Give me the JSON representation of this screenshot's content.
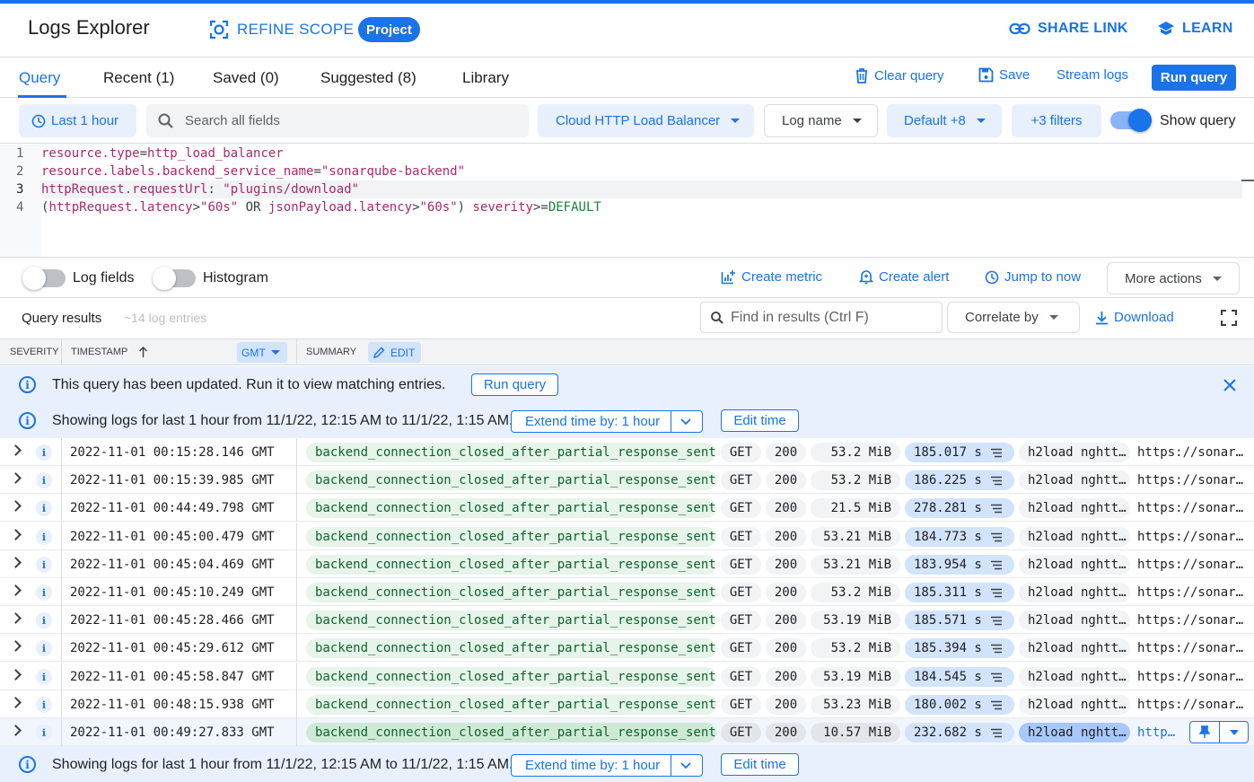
{
  "header": {
    "title": "Logs Explorer",
    "refine_scope": "REFINE SCOPE",
    "scope_badge": "Project",
    "share_link": "SHARE LINK",
    "learn": "LEARN"
  },
  "tabs": {
    "query": "Query",
    "recent": "Recent (1)",
    "saved": "Saved (0)",
    "suggested": "Suggested (8)",
    "library": "Library"
  },
  "toolbar": {
    "clear_query": "Clear query",
    "save": "Save",
    "stream_logs": "Stream logs",
    "run_query": "Run query"
  },
  "filters": {
    "time_range": "Last 1 hour",
    "search_placeholder": "Search all fields",
    "resource": "Cloud HTTP Load Balancer",
    "log_name": "Log name",
    "severity": "Default +8",
    "more_filters": "+3 filters",
    "show_query": "Show query",
    "show_query_on": true
  },
  "editor": {
    "line_numbers": [
      "1",
      "2",
      "3",
      "4"
    ],
    "lines": {
      "l1_key": "resource.type",
      "l1_op": "=",
      "l1_val": "http_load_balancer",
      "l2_key": "resource.labels.backend_service_name",
      "l2_op": "=",
      "l2_val": "\"sonarqube-backend\"",
      "l3_key": "httpRequest.requestUrl",
      "l3_op": ": ",
      "l3_val": "\"plugins/download\"",
      "l4_p1": "(",
      "l4_key1": "httpRequest.latency",
      "l4_op1": ">",
      "l4_val1": "\"60s\"",
      "l4_or": " OR ",
      "l4_key2": "jsonPayload.latency",
      "l4_op2": ">",
      "l4_val2": "\"60s\"",
      "l4_p2": ") ",
      "l4_key3": "severity",
      "l4_op3": ">=",
      "l4_val3": "DEFAULT"
    }
  },
  "actions": {
    "log_fields": "Log fields",
    "histogram": "Histogram",
    "create_metric": "Create metric",
    "create_alert": "Create alert",
    "jump_to_now": "Jump to now",
    "more_actions": "More actions"
  },
  "results": {
    "title": "Query results",
    "count": "~14 log entries",
    "find_placeholder": "Find in results (Ctrl F)",
    "correlate_by": "Correlate by",
    "download": "Download"
  },
  "columns": {
    "severity": "SEVERITY",
    "timestamp": "TIMESTAMP",
    "timezone": "GMT",
    "summary": "SUMMARY",
    "edit": "EDIT"
  },
  "banners": {
    "query_updated": "This query has been updated. Run it to view matching entries.",
    "run_query": "Run query",
    "showing_logs": "Showing logs for last 1 hour from 11/1/22, 12:15 AM to 11/1/22, 1:15 AM.",
    "extend_time": "Extend time by: 1 hour",
    "edit_time": "Edit time"
  },
  "rows": [
    {
      "sev": "i",
      "ts": "2022-11-01 00:15:28.146 GMT",
      "status_detail": "backend_connection_closed_after_partial_response_sent",
      "method": "GET",
      "code": "200",
      "size": "53.2 MiB",
      "latency": "185.017 s",
      "agent": "h2load nghtt…",
      "url": "https://sonar…"
    },
    {
      "sev": "i",
      "ts": "2022-11-01 00:15:39.985 GMT",
      "status_detail": "backend_connection_closed_after_partial_response_sent",
      "method": "GET",
      "code": "200",
      "size": "53.2 MiB",
      "latency": "186.225 s",
      "agent": "h2load nghtt…",
      "url": "https://sonar…"
    },
    {
      "sev": "i",
      "ts": "2022-11-01 00:44:49.798 GMT",
      "status_detail": "backend_connection_closed_after_partial_response_sent",
      "method": "GET",
      "code": "200",
      "size": "21.5 MiB",
      "latency": "278.281 s",
      "agent": "h2load nghtt…",
      "url": "https://sonar…"
    },
    {
      "sev": "i",
      "ts": "2022-11-01 00:45:00.479 GMT",
      "status_detail": "backend_connection_closed_after_partial_response_sent",
      "method": "GET",
      "code": "200",
      "size": "53.21 MiB",
      "latency": "184.773 s",
      "agent": "h2load nghtt…",
      "url": "https://sonar…"
    },
    {
      "sev": "i",
      "ts": "2022-11-01 00:45:04.469 GMT",
      "status_detail": "backend_connection_closed_after_partial_response_sent",
      "method": "GET",
      "code": "200",
      "size": "53.21 MiB",
      "latency": "183.954 s",
      "agent": "h2load nghtt…",
      "url": "https://sonar…"
    },
    {
      "sev": "i",
      "ts": "2022-11-01 00:45:10.249 GMT",
      "status_detail": "backend_connection_closed_after_partial_response_sent",
      "method": "GET",
      "code": "200",
      "size": "53.2 MiB",
      "latency": "185.311 s",
      "agent": "h2load nghtt…",
      "url": "https://sonar…"
    },
    {
      "sev": "i",
      "ts": "2022-11-01 00:45:28.466 GMT",
      "status_detail": "backend_connection_closed_after_partial_response_sent",
      "method": "GET",
      "code": "200",
      "size": "53.19 MiB",
      "latency": "185.571 s",
      "agent": "h2load nghtt…",
      "url": "https://sonar…"
    },
    {
      "sev": "i",
      "ts": "2022-11-01 00:45:29.612 GMT",
      "status_detail": "backend_connection_closed_after_partial_response_sent",
      "method": "GET",
      "code": "200",
      "size": "53.2 MiB",
      "latency": "185.394 s",
      "agent": "h2load nghtt…",
      "url": "https://sonar…"
    },
    {
      "sev": "i",
      "ts": "2022-11-01 00:45:58.847 GMT",
      "status_detail": "backend_connection_closed_after_partial_response_sent",
      "method": "GET",
      "code": "200",
      "size": "53.19 MiB",
      "latency": "184.545 s",
      "agent": "h2load nghtt…",
      "url": "https://sonar…"
    },
    {
      "sev": "i",
      "ts": "2022-11-01 00:48:15.938 GMT",
      "status_detail": "backend_connection_closed_after_partial_response_sent",
      "method": "GET",
      "code": "200",
      "size": "53.23 MiB",
      "latency": "180.002 s",
      "agent": "h2load nghtt…",
      "url": "https://sonar…"
    },
    {
      "sev": "i",
      "ts": "2022-11-01 00:49:27.833 GMT",
      "status_detail": "backend_connection_closed_after_partial_response_sent",
      "method": "GET",
      "code": "200",
      "size": "10.57 MiB",
      "latency": "232.682 s",
      "agent": "h2load nghtt…",
      "url": "http…"
    }
  ],
  "colors": {
    "accent": "#1a73e8",
    "banner_bg": "#e8f0fe",
    "status_pill": "#e6f4ea",
    "latency_pill": "#d2e3fc"
  }
}
